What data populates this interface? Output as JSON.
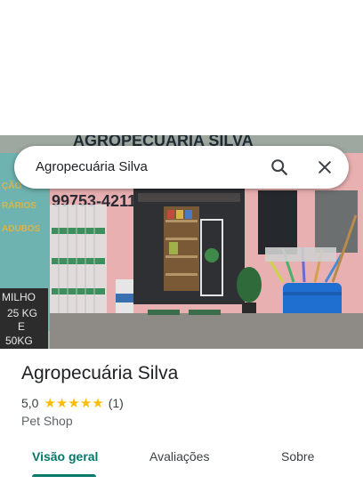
{
  "search": {
    "query": "Agropecuária Silva"
  },
  "photo": {
    "storefront_sign": "AGROPECUÁRIA SILVA",
    "phone_partial": "99753-4211",
    "chalkboard_lines": [
      "MILHO",
      "25 KG",
      "E",
      "50KG"
    ]
  },
  "place": {
    "name": "Agropecuária Silva",
    "rating": "5,0",
    "stars": 5,
    "review_count": "(1)",
    "category": "Pet Shop"
  },
  "tabs": [
    {
      "label": "Visão geral",
      "active": true
    },
    {
      "label": "Avaliações",
      "active": false
    },
    {
      "label": "Sobre",
      "active": false
    }
  ],
  "colors": {
    "accent": "#00796b",
    "star": "#fbbc04",
    "text_primary": "#202124",
    "text_secondary": "#5f6368"
  },
  "icons": {
    "search": "search-icon",
    "close": "close-icon",
    "star": "star-icon"
  }
}
